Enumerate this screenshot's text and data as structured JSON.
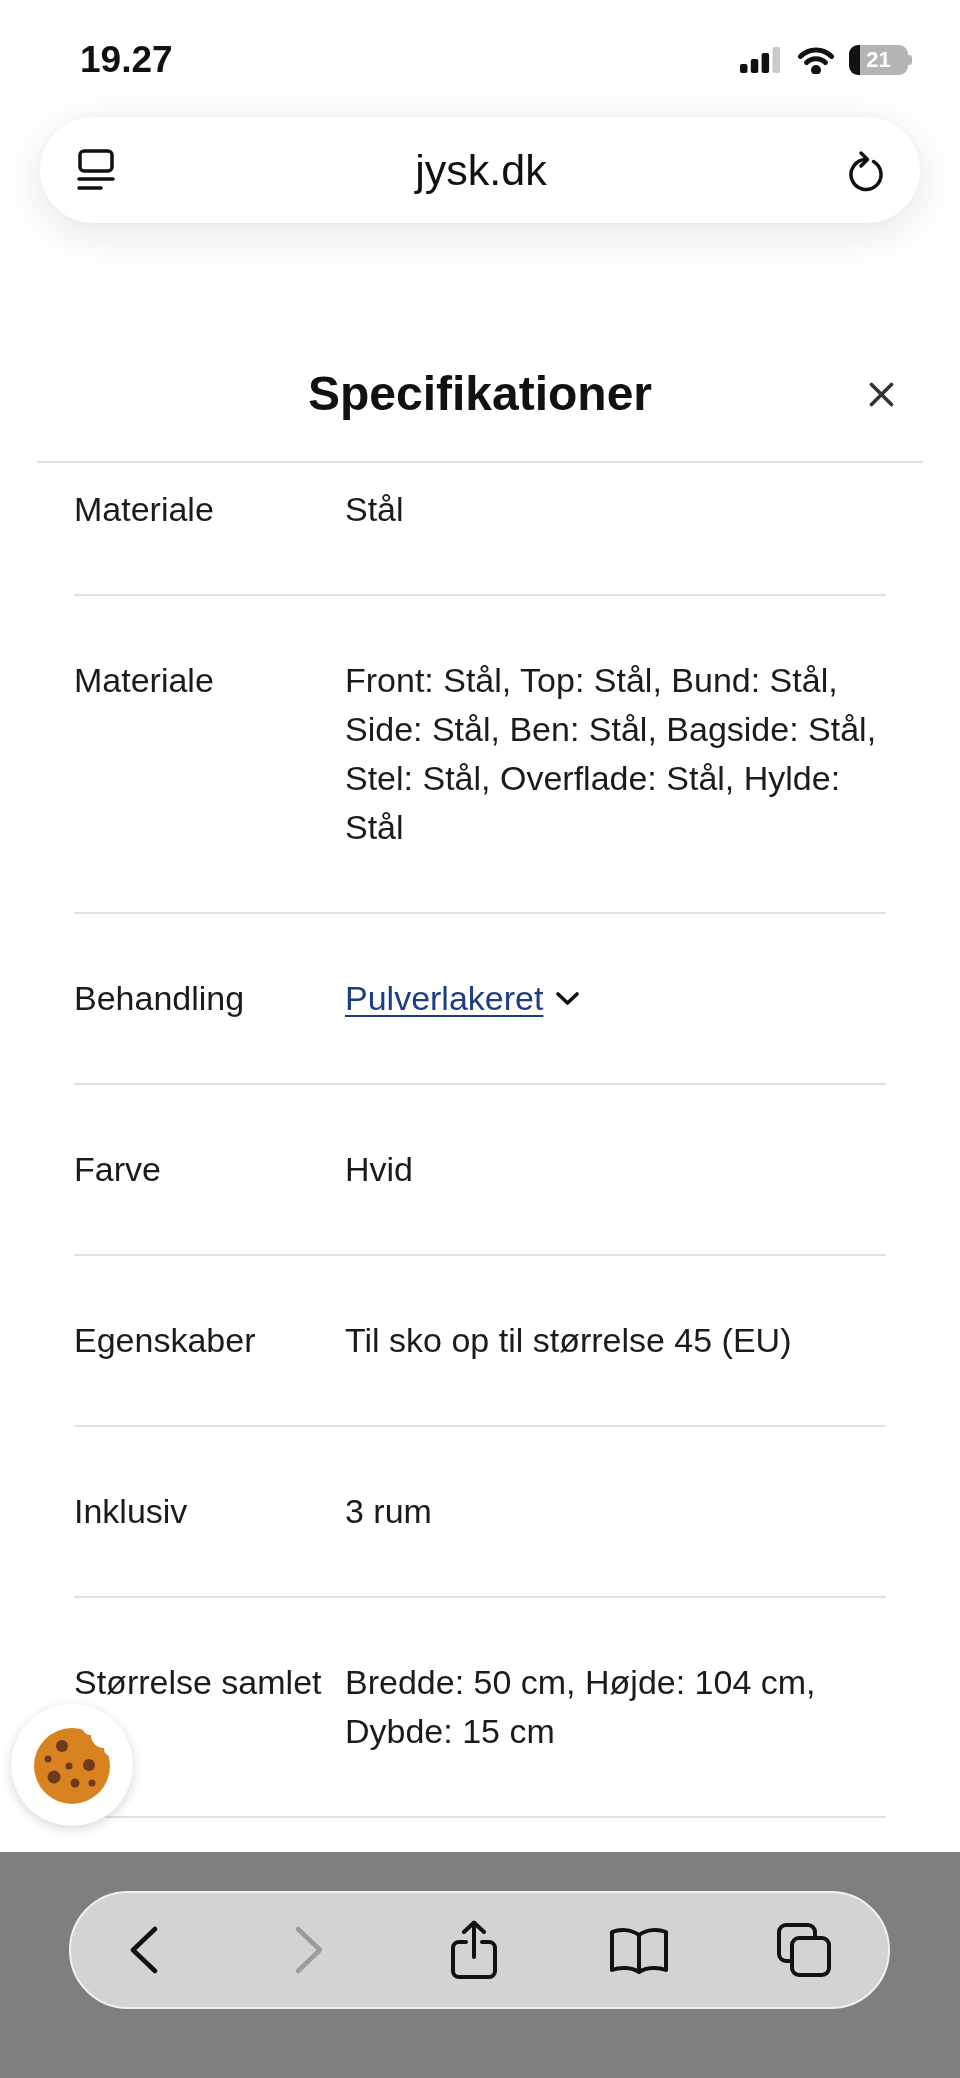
{
  "status_bar": {
    "time": "19.27",
    "battery": "21"
  },
  "address_bar": {
    "url": "jysk.dk"
  },
  "panel": {
    "title": "Specifikationer",
    "specs": [
      {
        "kind": "text",
        "label": "Materiale",
        "value": "Stål"
      },
      {
        "kind": "text",
        "label": "Materiale",
        "value": "Front: Stål, Top: Stål, Bund: Stål, Side: Stål, Ben: Stål, Bagside: Stål, Stel: Stål, Overflade: Stål, Hylde: Stål"
      },
      {
        "kind": "link",
        "label": "Behandling",
        "value": "Pulverlakeret",
        "expanded": false
      },
      {
        "kind": "text",
        "label": "Farve",
        "value": "Hvid"
      },
      {
        "kind": "text",
        "label": "Egenskaber",
        "value": "Til sko op til størrelse 45 (EU)"
      },
      {
        "kind": "text",
        "label": "Inklusiv",
        "value": "3 rum"
      },
      {
        "kind": "text",
        "label": "Størrelse samlet",
        "value": "Bredde: 50 cm, Højde: 104 cm, Dybde: 15 cm"
      }
    ]
  },
  "toolbar": {
    "buttons": [
      {
        "kind": "back",
        "disabled": false
      },
      {
        "kind": "forward",
        "disabled": true
      },
      {
        "kind": "share",
        "disabled": false
      },
      {
        "kind": "bookmarks",
        "disabled": false
      },
      {
        "kind": "tabs",
        "disabled": false
      }
    ]
  }
}
